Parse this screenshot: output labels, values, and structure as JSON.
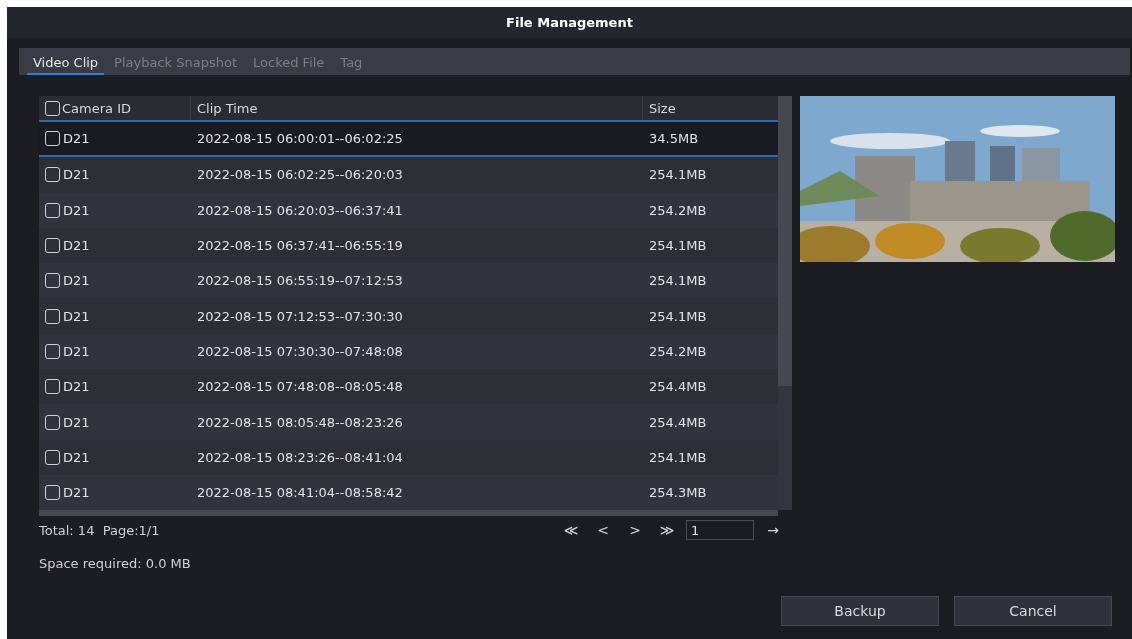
{
  "window": {
    "title": "File Management"
  },
  "tabs": [
    {
      "label": "Video Clip",
      "selected": true
    },
    {
      "label": "Playback Snapshot",
      "selected": false
    },
    {
      "label": "Locked File",
      "selected": false
    },
    {
      "label": "Tag",
      "selected": false
    }
  ],
  "table": {
    "select_all": {
      "checked": false
    },
    "columns": [
      "Camera ID",
      "Clip Time",
      "Size"
    ],
    "rows": [
      {
        "camera": "D21",
        "time": "2022-08-15 06:00:01--06:02:25",
        "size": "34.5MB",
        "checked": false,
        "selected": true
      },
      {
        "camera": "D21",
        "time": "2022-08-15 06:02:25--06:20:03",
        "size": "254.1MB",
        "checked": false,
        "selected": false
      },
      {
        "camera": "D21",
        "time": "2022-08-15 06:20:03--06:37:41",
        "size": "254.2MB",
        "checked": false,
        "selected": false
      },
      {
        "camera": "D21",
        "time": "2022-08-15 06:37:41--06:55:19",
        "size": "254.1MB",
        "checked": false,
        "selected": false
      },
      {
        "camera": "D21",
        "time": "2022-08-15 06:55:19--07:12:53",
        "size": "254.1MB",
        "checked": false,
        "selected": false
      },
      {
        "camera": "D21",
        "time": "2022-08-15 07:12:53--07:30:30",
        "size": "254.1MB",
        "checked": false,
        "selected": false
      },
      {
        "camera": "D21",
        "time": "2022-08-15 07:30:30--07:48:08",
        "size": "254.2MB",
        "checked": false,
        "selected": false
      },
      {
        "camera": "D21",
        "time": "2022-08-15 07:48:08--08:05:48",
        "size": "254.4MB",
        "checked": false,
        "selected": false
      },
      {
        "camera": "D21",
        "time": "2022-08-15 08:05:48--08:23:26",
        "size": "254.4MB",
        "checked": false,
        "selected": false
      },
      {
        "camera": "D21",
        "time": "2022-08-15 08:23:26--08:41:04",
        "size": "254.1MB",
        "checked": false,
        "selected": false
      },
      {
        "camera": "D21",
        "time": "2022-08-15 08:41:04--08:58:42",
        "size": "254.3MB",
        "checked": false,
        "selected": false
      }
    ]
  },
  "preview": {
    "kind": "picture"
  },
  "summary": {
    "total": "Total: 14",
    "page": "Page:1/1",
    "space": "Space required: 0.0 MB"
  },
  "pager": {
    "first": "≪",
    "prev": "<",
    "next": ">",
    "last": "≫",
    "page_value": "1",
    "go": "→"
  },
  "buttons": [
    "Backup",
    "Cancel"
  ]
}
